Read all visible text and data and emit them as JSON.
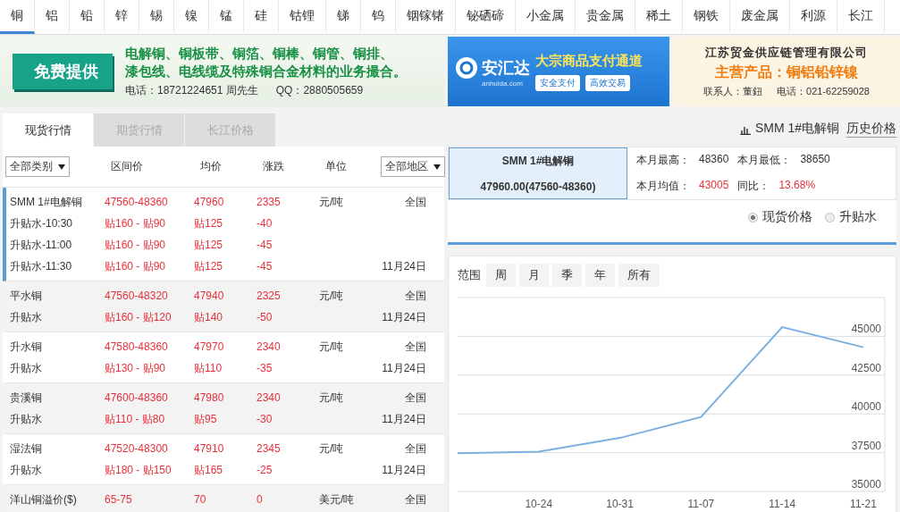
{
  "metal_tabs": [
    {
      "label": "铜",
      "selected": true
    },
    {
      "label": "铝",
      "selected": false
    },
    {
      "label": "铅",
      "selected": false
    },
    {
      "label": "锌",
      "selected": false
    },
    {
      "label": "锡",
      "selected": false
    },
    {
      "label": "镍",
      "selected": false
    },
    {
      "label": "锰",
      "selected": false
    },
    {
      "label": "硅",
      "selected": false
    },
    {
      "label": "钴锂",
      "selected": false
    },
    {
      "label": "锑",
      "selected": false
    },
    {
      "label": "钨",
      "selected": false
    },
    {
      "label": "铟镓锗",
      "selected": false
    },
    {
      "label": "铋硒碲",
      "selected": false
    },
    {
      "label": "小金属",
      "selected": false
    },
    {
      "label": "贵金属",
      "selected": false
    },
    {
      "label": "稀土",
      "selected": false
    },
    {
      "label": "钢铁",
      "selected": false
    },
    {
      "label": "废金属",
      "selected": false
    },
    {
      "label": "利源",
      "selected": false
    },
    {
      "label": "长江",
      "selected": false
    }
  ],
  "ads": [
    {
      "kind": "service",
      "badge": "免费提供",
      "lines": [
        "电解铜、铜板带、铜箔、铜棒、铜管、铜排、",
        "漆包线、电线缆及特殊铜合金材料的业务撮合。"
      ],
      "phone": "电话：18721224651  周先生",
      "qq": "QQ：2880505659"
    },
    {
      "kind": "payment",
      "logo": "安汇达",
      "logo_sub": "anhuida.com",
      "headline": "大宗商品支付通道",
      "features": [
        "安全支付",
        "高效交易"
      ]
    },
    {
      "kind": "company",
      "company": "江苏贸金供应链管理有限公司",
      "product": "主营产品：铜铝铅锌镍",
      "contact": "联系人：董鈕",
      "phone": "电话：021-62259028"
    }
  ],
  "market": {
    "tabs": [
      {
        "label": "现货行情",
        "selected": true
      },
      {
        "label": "期货行情",
        "selected": false
      },
      {
        "label": "长江价格",
        "selected": false
      }
    ],
    "category_select": "全部类别",
    "region_select": "全部地区",
    "columns": [
      "区间价",
      "均价",
      "涨跌",
      "单位"
    ],
    "groups": [
      {
        "selected": true,
        "rows": [
          {
            "name": "SMM 1#电解铜",
            "range": "47560-48360",
            "avg": "47960",
            "change": "2335",
            "unit": "元/吨",
            "region": "全国"
          },
          {
            "name": "升贴水-10:30",
            "range": "贴160 - 贴90",
            "avg": "贴125",
            "change": "-40"
          },
          {
            "name": "升贴水-11:00",
            "range": "贴160 - 贴90",
            "avg": "贴125",
            "change": "-45"
          },
          {
            "name": "升贴水-11:30",
            "range": "贴160 - 贴90",
            "avg": "贴125",
            "change": "-45",
            "region": "11月24日"
          }
        ]
      },
      {
        "selected": false,
        "rows": [
          {
            "name": "平水铜",
            "range": "47560-48320",
            "avg": "47940",
            "change": "2325",
            "unit": "元/吨",
            "region": "全国"
          },
          {
            "name": "升贴水",
            "range": "贴160 - 贴120",
            "avg": "贴140",
            "change": "-50",
            "region": "11月24日"
          }
        ]
      },
      {
        "selected": false,
        "rows": [
          {
            "name": "升水铜",
            "range": "47580-48360",
            "avg": "47970",
            "change": "2340",
            "unit": "元/吨",
            "region": "全国"
          },
          {
            "name": "升贴水",
            "range": "贴130 - 贴90",
            "avg": "贴110",
            "change": "-35",
            "region": "11月24日"
          }
        ]
      },
      {
        "selected": false,
        "rows": [
          {
            "name": "贵溪铜",
            "range": "47600-48360",
            "avg": "47980",
            "change": "2340",
            "unit": "元/吨",
            "region": "全国"
          },
          {
            "name": "升贴水",
            "range": "贴110 - 贴80",
            "avg": "贴95",
            "change": "-30",
            "region": "11月24日"
          }
        ]
      },
      {
        "selected": false,
        "rows": [
          {
            "name": "湿法铜",
            "range": "47520-48300",
            "avg": "47910",
            "change": "2345",
            "unit": "元/吨",
            "region": "全国"
          },
          {
            "name": "升贴水",
            "range": "贴180 - 贴150",
            "avg": "贴165",
            "change": "-25",
            "region": "11月24日"
          }
        ]
      },
      {
        "selected": false,
        "rows": [
          {
            "name": "洋山铜溢价($)",
            "range": "65-75",
            "avg": "70",
            "change": "0",
            "unit": "美元/吨",
            "region": "全国"
          }
        ]
      }
    ]
  },
  "detail": {
    "product_link": "SMM 1#电解铜",
    "history_link": "历史价格",
    "product": "SMM 1#电解铜",
    "price": "47960.00(47560-48360)",
    "stats": [
      [
        {
          "label": "本月最高：",
          "value": "48360",
          "highlight": false
        },
        {
          "label": "本月最低：",
          "value": "38650",
          "highlight": false
        }
      ],
      [
        {
          "label": "本月均值：",
          "value": "43005",
          "highlight": true
        },
        {
          "label": "同比：",
          "value": "13.68%",
          "highlight": true
        }
      ]
    ],
    "radios": [
      {
        "label": "现货价格",
        "selected": true
      },
      {
        "label": "升贴水",
        "selected": false
      }
    ],
    "range_label": "范围",
    "ranges": [
      "周",
      "月",
      "季",
      "年",
      "所有"
    ],
    "chart_data": {
      "type": "line",
      "grid": true,
      "categories": [
        null,
        "10-24",
        "10-31",
        "11-07",
        "11-14",
        "11-21"
      ],
      "ylim": [
        35000,
        47500
      ],
      "yticks": [
        35000,
        37500,
        40000,
        42500,
        45000
      ],
      "series": [
        {
          "color": "#7cb0e0",
          "values": [
            37460,
            37560,
            38450,
            39800,
            45600,
            44300
          ]
        }
      ]
    }
  }
}
